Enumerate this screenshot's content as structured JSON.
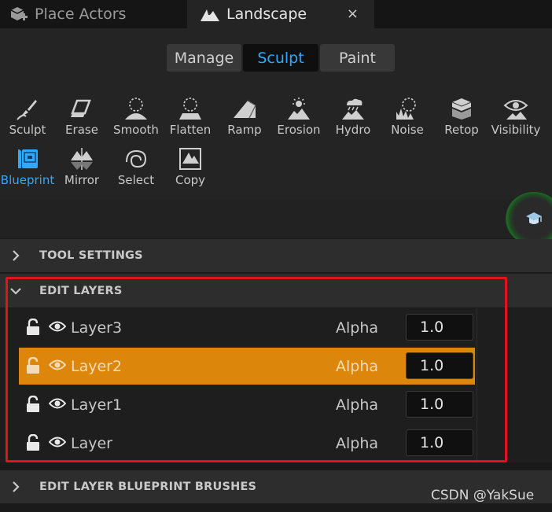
{
  "tabs": {
    "place_actors": "Place Actors",
    "landscape": "Landscape",
    "close": "×"
  },
  "modes": [
    "Manage",
    "Sculpt",
    "Paint"
  ],
  "active_mode": "Sculpt",
  "tools": [
    {
      "label": "Sculpt",
      "icon": "sculpt-icon"
    },
    {
      "label": "Erase",
      "icon": "erase-icon"
    },
    {
      "label": "Smooth",
      "icon": "smooth-icon"
    },
    {
      "label": "Flatten",
      "icon": "flatten-icon"
    },
    {
      "label": "Ramp",
      "icon": "ramp-icon"
    },
    {
      "label": "Erosion",
      "icon": "erosion-icon"
    },
    {
      "label": "Hydro",
      "icon": "hydro-icon"
    },
    {
      "label": "Noise",
      "icon": "noise-icon"
    },
    {
      "label": "Retop",
      "icon": "retop-icon"
    },
    {
      "label": "Visibility",
      "icon": "visibility-icon"
    },
    {
      "label": "Blueprint",
      "icon": "blueprint-icon"
    },
    {
      "label": "Mirror",
      "icon": "mirror-icon"
    },
    {
      "label": "Select",
      "icon": "select-icon"
    },
    {
      "label": "Copy",
      "icon": "copy-icon"
    }
  ],
  "active_tool": "Blueprint",
  "sections": {
    "tool_settings": "TOOL SETTINGS",
    "edit_layers": "EDIT LAYERS",
    "edit_layer_bp": "EDIT LAYER BLUEPRINT BRUSHES"
  },
  "layers": [
    {
      "name": "Layer3",
      "alpha_label": "Alpha",
      "alpha": "1.0"
    },
    {
      "name": "Layer2",
      "alpha_label": "Alpha",
      "alpha": "1.0"
    },
    {
      "name": "Layer1",
      "alpha_label": "Alpha",
      "alpha": "1.0"
    },
    {
      "name": "Layer",
      "alpha_label": "Alpha",
      "alpha": "1.0"
    }
  ],
  "selected_layer": "Layer2",
  "colors": {
    "accent_blue": "#2fa8ff",
    "selected_orange": "#dc870c",
    "annotation_red": "#e0141e"
  },
  "watermark": "CSDN @YakSue"
}
